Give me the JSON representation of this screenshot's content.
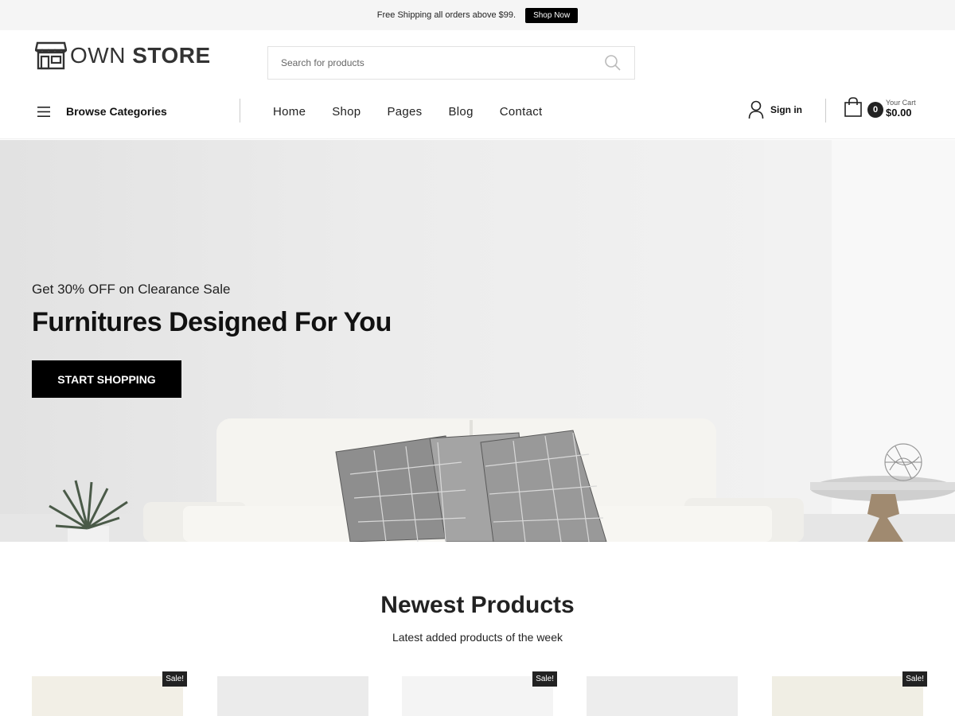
{
  "topbar": {
    "message": "Free Shipping all orders above $99.",
    "cta": "Shop Now"
  },
  "logo": {
    "light": "OWN ",
    "bold": "STORE"
  },
  "search": {
    "placeholder": "Search for products"
  },
  "nav": {
    "browse_label": "Browse Categories",
    "menu": [
      "Home",
      "Shop",
      "Pages",
      "Blog",
      "Contact"
    ],
    "signin": "Sign in",
    "cart": {
      "count": "0",
      "label": "Your Cart",
      "total": "$0.00"
    }
  },
  "hero": {
    "subtitle": "Get 30% OFF on Clearance Sale",
    "title": "Furnitures Designed For You",
    "button": "START SHOPPING"
  },
  "newest": {
    "title": "Newest Products",
    "subtitle": "Latest added products of the week",
    "cards": [
      {
        "color": "#f2efe6",
        "sale": "Sale!"
      },
      {
        "color": "#ebebeb",
        "sale": ""
      },
      {
        "color": "#f4f4f4",
        "sale": "Sale!"
      },
      {
        "color": "#ededed",
        "sale": ""
      },
      {
        "color": "#f0eee4",
        "sale": "Sale!"
      }
    ]
  },
  "colors": {
    "accent": "#000000",
    "topbar_bg": "#f5f5f5",
    "badge": "#222222"
  }
}
